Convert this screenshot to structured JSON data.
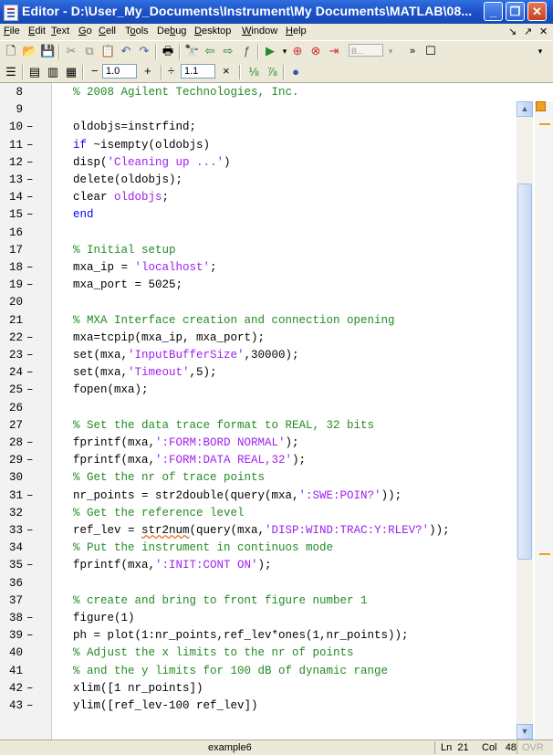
{
  "window": {
    "title": "Editor - D:\\User_My_Documents\\Instrument\\My Documents\\MATLAB\\08...",
    "controls": [
      "minimize-icon",
      "maximize-icon",
      "close-icon"
    ]
  },
  "menu": {
    "items": [
      {
        "pre": "",
        "u": "F",
        "post": "ile"
      },
      {
        "pre": "",
        "u": "E",
        "post": "dit"
      },
      {
        "pre": "",
        "u": "T",
        "post": "ext"
      },
      {
        "pre": "",
        "u": "G",
        "post": "o"
      },
      {
        "pre": "",
        "u": "C",
        "post": "ell"
      },
      {
        "pre": "T",
        "u": "o",
        "post": "ols"
      },
      {
        "pre": "De",
        "u": "b",
        "post": "ug"
      },
      {
        "pre": "",
        "u": "D",
        "post": "esktop"
      },
      {
        "pre": "",
        "u": "W",
        "post": "indow"
      },
      {
        "pre": "",
        "u": "H",
        "post": "elp"
      }
    ],
    "right": [
      "↘",
      "↗",
      "✕"
    ]
  },
  "toolbar": {
    "stack_label": "B...",
    "cell_minus": "−",
    "cell_value_1": "1.0",
    "cell_plus": "+",
    "cell_div": "÷",
    "cell_value_2": "1.1",
    "cell_times": "×"
  },
  "code_lines": [
    {
      "n": "8",
      "bp": false,
      "segs": [
        [
          "comment",
          "% 2008 Agilent Technologies, Inc."
        ]
      ]
    },
    {
      "n": "9",
      "bp": false,
      "segs": []
    },
    {
      "n": "10",
      "bp": true,
      "segs": [
        [
          "code",
          "oldobjs=instrfind;"
        ]
      ]
    },
    {
      "n": "11",
      "bp": true,
      "segs": [
        [
          "keyword",
          "if"
        ],
        [
          "code",
          " ~isempty(oldobjs)"
        ]
      ]
    },
    {
      "n": "12",
      "bp": true,
      "segs": [
        [
          "code",
          "disp("
        ],
        [
          "string",
          "'Cleaning up ...'"
        ],
        [
          "code",
          ")"
        ]
      ]
    },
    {
      "n": "13",
      "bp": true,
      "segs": [
        [
          "code",
          "delete(oldobjs);"
        ]
      ]
    },
    {
      "n": "14",
      "bp": true,
      "segs": [
        [
          "code",
          "clear "
        ],
        [
          "string",
          "oldobjs"
        ],
        [
          "code",
          ";"
        ]
      ]
    },
    {
      "n": "15",
      "bp": true,
      "segs": [
        [
          "keyword",
          "end"
        ]
      ]
    },
    {
      "n": "16",
      "bp": false,
      "segs": []
    },
    {
      "n": "17",
      "bp": false,
      "segs": [
        [
          "comment",
          "% Initial setup"
        ]
      ]
    },
    {
      "n": "18",
      "bp": true,
      "segs": [
        [
          "code",
          "mxa_ip = "
        ],
        [
          "string",
          "'localhost'"
        ],
        [
          "code",
          ";"
        ]
      ]
    },
    {
      "n": "19",
      "bp": true,
      "segs": [
        [
          "code",
          "mxa_port = 5025;"
        ]
      ]
    },
    {
      "n": "20",
      "bp": false,
      "segs": []
    },
    {
      "n": "21",
      "bp": false,
      "segs": [
        [
          "comment",
          "% MXA Interface creation and connection opening"
        ]
      ]
    },
    {
      "n": "22",
      "bp": true,
      "segs": [
        [
          "code",
          "mxa=tcpip(mxa_ip, mxa_port);"
        ]
      ]
    },
    {
      "n": "23",
      "bp": true,
      "segs": [
        [
          "code",
          "set(mxa,"
        ],
        [
          "string",
          "'InputBufferSize'"
        ],
        [
          "code",
          ",30000);"
        ]
      ]
    },
    {
      "n": "24",
      "bp": true,
      "segs": [
        [
          "code",
          "set(mxa,"
        ],
        [
          "string",
          "'Timeout'"
        ],
        [
          "code",
          ",5);"
        ]
      ]
    },
    {
      "n": "25",
      "bp": true,
      "segs": [
        [
          "code",
          "fopen(mxa);"
        ]
      ]
    },
    {
      "n": "26",
      "bp": false,
      "segs": []
    },
    {
      "n": "27",
      "bp": false,
      "segs": [
        [
          "comment",
          "% Set the data trace format to REAL, 32 bits"
        ]
      ]
    },
    {
      "n": "28",
      "bp": true,
      "segs": [
        [
          "code",
          "fprintf(mxa,"
        ],
        [
          "string",
          "':FORM:BORD NORMAL'"
        ],
        [
          "code",
          ");"
        ]
      ]
    },
    {
      "n": "29",
      "bp": true,
      "segs": [
        [
          "code",
          "fprintf(mxa,"
        ],
        [
          "string",
          "':FORM:DATA REAL,32'"
        ],
        [
          "code",
          ");"
        ]
      ]
    },
    {
      "n": "30",
      "bp": false,
      "segs": [
        [
          "comment",
          "% Get the nr of trace points"
        ]
      ]
    },
    {
      "n": "31",
      "bp": true,
      "segs": [
        [
          "code",
          "nr_points = str2double(query(mxa,"
        ],
        [
          "string",
          "':SWE:POIN?'"
        ],
        [
          "code",
          "));"
        ]
      ]
    },
    {
      "n": "32",
      "bp": false,
      "segs": [
        [
          "comment",
          "% Get the reference level"
        ]
      ]
    },
    {
      "n": "33",
      "bp": true,
      "segs": [
        [
          "code",
          "ref_lev = "
        ],
        [
          "warn",
          "str2num"
        ],
        [
          "code",
          "(query(mxa,"
        ],
        [
          "string",
          "'DISP:WIND:TRAC:Y:RLEV?'"
        ],
        [
          "code",
          "));"
        ]
      ]
    },
    {
      "n": "34",
      "bp": false,
      "segs": [
        [
          "comment",
          "% Put the instrument in continuos mode"
        ]
      ]
    },
    {
      "n": "35",
      "bp": true,
      "segs": [
        [
          "code",
          "fprintf(mxa,"
        ],
        [
          "string",
          "':INIT:CONT ON'"
        ],
        [
          "code",
          ");"
        ]
      ]
    },
    {
      "n": "36",
      "bp": false,
      "segs": []
    },
    {
      "n": "37",
      "bp": false,
      "segs": [
        [
          "comment",
          "% create and bring to front figure number 1"
        ]
      ]
    },
    {
      "n": "38",
      "bp": true,
      "segs": [
        [
          "code",
          "figure(1)"
        ]
      ]
    },
    {
      "n": "39",
      "bp": true,
      "segs": [
        [
          "code",
          "ph = plot(1:nr_points,ref_lev*ones(1,nr_points));"
        ]
      ]
    },
    {
      "n": "40",
      "bp": false,
      "segs": [
        [
          "comment",
          "% Adjust the x limits to the nr of points"
        ]
      ]
    },
    {
      "n": "41",
      "bp": false,
      "segs": [
        [
          "comment",
          "% and the y limits for 100 dB of dynamic range"
        ]
      ]
    },
    {
      "n": "42",
      "bp": true,
      "segs": [
        [
          "code",
          "xlim([1 nr_points])"
        ]
      ]
    },
    {
      "n": "43",
      "bp": true,
      "segs": [
        [
          "code",
          "ylim([ref_lev-100 ref_lev])"
        ]
      ]
    }
  ],
  "status": {
    "file": "example6",
    "ln_label": "Ln",
    "ln_value": "21",
    "col_label": "Col",
    "col_value": "48",
    "ovr": "OVR"
  }
}
